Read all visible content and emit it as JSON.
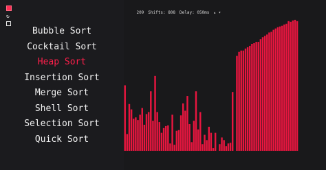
{
  "sidebar": {
    "controls": [
      {
        "name": "play-stop-icon"
      },
      {
        "name": "refresh-icon"
      },
      {
        "name": "sound-toggle-icon"
      }
    ],
    "algorithms": [
      {
        "label": "Bubble Sort",
        "active": false
      },
      {
        "label": "Cocktail Sort",
        "active": false
      },
      {
        "label": "Heap Sort",
        "active": true
      },
      {
        "label": "Insertion Sort",
        "active": false
      },
      {
        "label": "Merge Sort",
        "active": false
      },
      {
        "label": "Shell Sort",
        "active": false
      },
      {
        "label": "Selection Sort",
        "active": false
      },
      {
        "label": "Quick Sort",
        "active": false
      }
    ]
  },
  "status": {
    "count": "209",
    "shifts": "Shifts: 808",
    "delay": "Delay: 050ms",
    "arrows": "▴ ▾"
  },
  "colors": {
    "accent": "#ff1f4b",
    "bar": "#e8163f"
  },
  "chart_data": {
    "type": "bar",
    "values": [
      98,
      25,
      70,
      62,
      48,
      50,
      46,
      54,
      64,
      39,
      55,
      58,
      89,
      45,
      112,
      58,
      43,
      27,
      34,
      37,
      38,
      11,
      54,
      9,
      30,
      31,
      53,
      71,
      60,
      82,
      40,
      13,
      45,
      89,
      32,
      58,
      10,
      24,
      16,
      36,
      27,
      4,
      27,
      0,
      10,
      20,
      16,
      7,
      11,
      12,
      88,
      0,
      142,
      148,
      150,
      150,
      153,
      155,
      157,
      160,
      161,
      163,
      163,
      167,
      170,
      172,
      174,
      177,
      178,
      181,
      183,
      185,
      186,
      187,
      189,
      190,
      194,
      193,
      195,
      196,
      194
    ],
    "ylim": [
      0,
      200
    ]
  }
}
